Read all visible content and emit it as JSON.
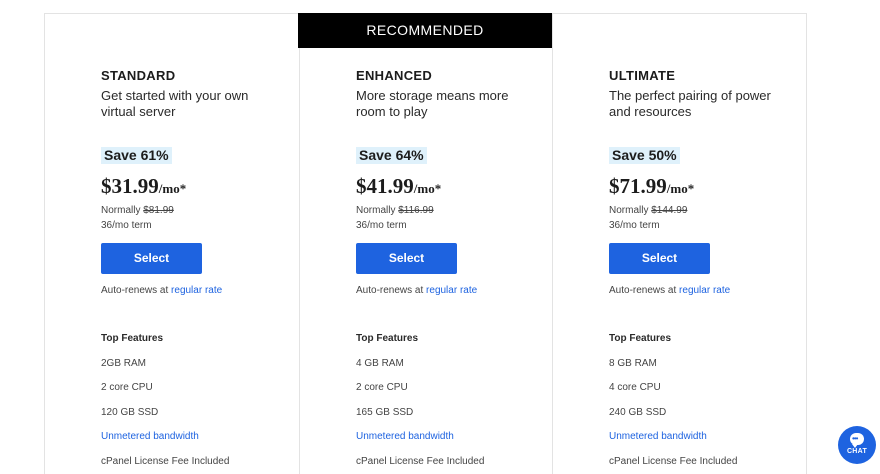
{
  "banner": "RECOMMENDED",
  "plans": [
    {
      "name": "STANDARD",
      "desc": "Get started with your own virtual server",
      "save": "Save 61%",
      "price": "$31.99",
      "unit": "/mo*",
      "normally_label": "Normally",
      "normally_price": "$81.99",
      "term": "36/mo term",
      "select_label": "Select",
      "renew_text": "Auto-renews at",
      "renew_link": "regular rate",
      "features_title": "Top Features",
      "features": [
        "2GB RAM",
        "2 core CPU",
        "120 GB SSD",
        "Unmetered bandwidth",
        "cPanel License Fee Included"
      ]
    },
    {
      "name": "ENHANCED",
      "desc": "More storage means more room to play",
      "save": "Save 64%",
      "price": "$41.99",
      "unit": "/mo*",
      "normally_label": "Normally",
      "normally_price": "$116.99",
      "term": "36/mo term",
      "select_label": "Select",
      "renew_text": "Auto-renews at",
      "renew_link": "regular rate",
      "features_title": "Top Features",
      "features": [
        "4 GB RAM",
        "2 core CPU",
        "165 GB SSD",
        "Unmetered bandwidth",
        "cPanel License Fee Included"
      ]
    },
    {
      "name": "ULTIMATE",
      "desc": "The perfect pairing of power and resources",
      "save": "Save 50%",
      "price": "$71.99",
      "unit": "/mo*",
      "normally_label": "Normally",
      "normally_price": "$144.99",
      "term": "36/mo term",
      "select_label": "Select",
      "renew_text": "Auto-renews at",
      "renew_link": "regular rate",
      "features_title": "Top Features",
      "features": [
        "8 GB RAM",
        "4 core CPU",
        "240 GB SSD",
        "Unmetered bandwidth",
        "cPanel License Fee Included"
      ]
    }
  ],
  "chat": {
    "label": "CHAT",
    "icon": "chat-bubble-icon"
  },
  "colors": {
    "accent": "#1e63e0",
    "save_highlight": "#dff1fb",
    "banner_bg": "#000000"
  }
}
